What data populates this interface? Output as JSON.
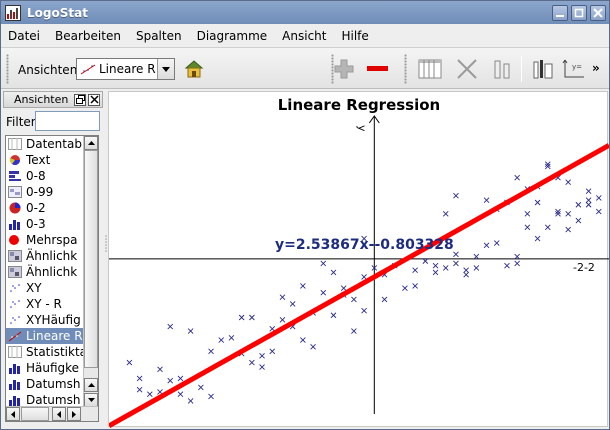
{
  "window": {
    "title": "LogoStat"
  },
  "menu": [
    "Datei",
    "Bearbeiten",
    "Spalten",
    "Diagramme",
    "Ansicht",
    "Hilfe"
  ],
  "toolbar": {
    "ansichten_label": "Ansichten",
    "view_selected": "Lineare R",
    "more": "»"
  },
  "sidepanel": {
    "title": "Ansichten",
    "filter_label": "Filter",
    "filter_value": "",
    "items": [
      {
        "label": "Datentab",
        "icon": "table-icon"
      },
      {
        "label": "Text",
        "icon": "text-pie-icon"
      },
      {
        "label": "0-8",
        "icon": "bar-h-icon"
      },
      {
        "label": "0-99",
        "icon": "grid-image-icon"
      },
      {
        "label": "0-2",
        "icon": "pie-icon"
      },
      {
        "label": "0-3",
        "icon": "bar-v-icon"
      },
      {
        "label": "Mehrspa",
        "icon": "red-dot-icon"
      },
      {
        "label": "Ähnlichk",
        "icon": "heatmap-icon"
      },
      {
        "label": "Ähnlichk",
        "icon": "heatmap-icon"
      },
      {
        "label": "XY",
        "icon": "scatter-icon"
      },
      {
        "label": "XY - R",
        "icon": "scatter-icon"
      },
      {
        "label": "XYHäufig",
        "icon": "scatter-icon"
      },
      {
        "label": "Lineare R",
        "icon": "regression-icon"
      },
      {
        "label": "Statistikta",
        "icon": "table-icon"
      },
      {
        "label": "Häufigke",
        "icon": "bar-v-icon"
      },
      {
        "label": "Datumsh",
        "icon": "bar-v-icon"
      },
      {
        "label": "Datumsh",
        "icon": "bar-v-icon"
      }
    ],
    "selected_index": 12
  },
  "chart_data": {
    "type": "scatter",
    "title": "Lineare Regression",
    "equation_label": "y=2.53867x--0.803328",
    "xlabel": "",
    "ylabel": "",
    "y_axis_tick_label": "y",
    "x_axis_tick_label": "-2-2",
    "xlim": [
      -2.6,
      2.3
    ],
    "ylim": [
      -7.5,
      7.4
    ],
    "grid": false,
    "series": [
      {
        "points": [
          [
            -2.4,
            -4.6
          ],
          [
            -2.3,
            -5.3
          ],
          [
            -2.3,
            -5.8
          ],
          [
            -2.2,
            -6.0
          ],
          [
            -2.1,
            -5.9
          ],
          [
            -2.1,
            -4.9
          ],
          [
            -2.0,
            -5.4
          ],
          [
            -2.0,
            -3.0
          ],
          [
            -1.9,
            -6.0
          ],
          [
            -1.9,
            -5.3
          ],
          [
            -1.8,
            -6.3
          ],
          [
            -1.8,
            -3.2
          ],
          [
            -1.7,
            -5.7
          ],
          [
            -1.6,
            -4.1
          ],
          [
            -1.6,
            -6.1
          ],
          [
            -1.5,
            -3.6
          ],
          [
            -1.4,
            -3.5
          ],
          [
            -1.3,
            -4.2
          ],
          [
            -1.3,
            -2.6
          ],
          [
            -1.2,
            -2.6
          ],
          [
            -1.2,
            -4.6
          ],
          [
            -1.1,
            -4.3
          ],
          [
            -1.1,
            -4.8
          ],
          [
            -1.0,
            -3.1
          ],
          [
            -1.0,
            -4.1
          ],
          [
            -0.9,
            -1.7
          ],
          [
            -0.9,
            -2.7
          ],
          [
            -0.8,
            -2.0
          ],
          [
            -0.8,
            -3.0
          ],
          [
            -0.7,
            -1.2
          ],
          [
            -0.7,
            -3.6
          ],
          [
            -0.6,
            -3.9
          ],
          [
            -0.6,
            -2.4
          ],
          [
            -0.5,
            -0.2
          ],
          [
            -0.5,
            -1.5
          ],
          [
            -0.4,
            -2.5
          ],
          [
            -0.4,
            -0.6
          ],
          [
            -0.3,
            -1.6
          ],
          [
            -0.3,
            -1.3
          ],
          [
            -0.2,
            -3.2
          ],
          [
            -0.2,
            -1.8
          ],
          [
            -0.1,
            -0.8
          ],
          [
            -0.1,
            0.9
          ],
          [
            -0.1,
            -2.3
          ],
          [
            0.0,
            -0.4
          ],
          [
            0.1,
            -1.8
          ],
          [
            0.1,
            -0.7
          ],
          [
            0.2,
            -0.3
          ],
          [
            0.3,
            -1.3
          ],
          [
            0.4,
            -1.2
          ],
          [
            0.4,
            -0.5
          ],
          [
            0.5,
            -0.1
          ],
          [
            0.6,
            -0.3
          ],
          [
            0.6,
            -0.6
          ],
          [
            0.7,
            -0.4
          ],
          [
            0.8,
            0.2
          ],
          [
            0.8,
            -0.2
          ],
          [
            0.9,
            -0.7
          ],
          [
            0.9,
            -0.5
          ],
          [
            1.0,
            0.1
          ],
          [
            1.0,
            -0.4
          ],
          [
            1.1,
            0.6
          ],
          [
            1.2,
            0.7
          ],
          [
            1.3,
            -0.3
          ],
          [
            1.4,
            0.1
          ],
          [
            1.4,
            -0.2
          ],
          [
            1.5,
            1.4
          ],
          [
            1.6,
            0.9
          ],
          [
            1.7,
            1.4
          ],
          [
            1.8,
            2.0
          ],
          [
            1.8,
            2.1
          ],
          [
            1.9,
            1.3
          ],
          [
            2.0,
            1.7
          ],
          [
            2.1,
            2.6
          ],
          [
            2.1,
            2.4
          ],
          [
            2.2,
            2.1
          ],
          [
            0.7,
            2.0
          ],
          [
            0.8,
            2.8
          ],
          [
            1.1,
            2.6
          ],
          [
            1.2,
            2.2
          ],
          [
            1.3,
            2.5
          ],
          [
            1.4,
            3.6
          ],
          [
            1.5,
            2.0
          ],
          [
            1.6,
            3.2
          ],
          [
            1.7,
            4.2
          ],
          [
            1.7,
            4.1
          ],
          [
            1.8,
            3.6
          ],
          [
            1.9,
            3.4
          ],
          [
            2.0,
            2.4
          ],
          [
            2.1,
            3.0
          ],
          [
            2.2,
            2.7
          ],
          [
            1.5,
            3.1
          ],
          [
            1.6,
            2.5
          ],
          [
            1.9,
            2.0
          ]
        ]
      }
    ],
    "regression": {
      "slope": 2.53867,
      "intercept": -0.803328
    }
  },
  "colors": {
    "accent": "#6f8db8",
    "points": "#2a2a8c",
    "regression_line": "#ff0000",
    "equation": "#1d2b80"
  }
}
